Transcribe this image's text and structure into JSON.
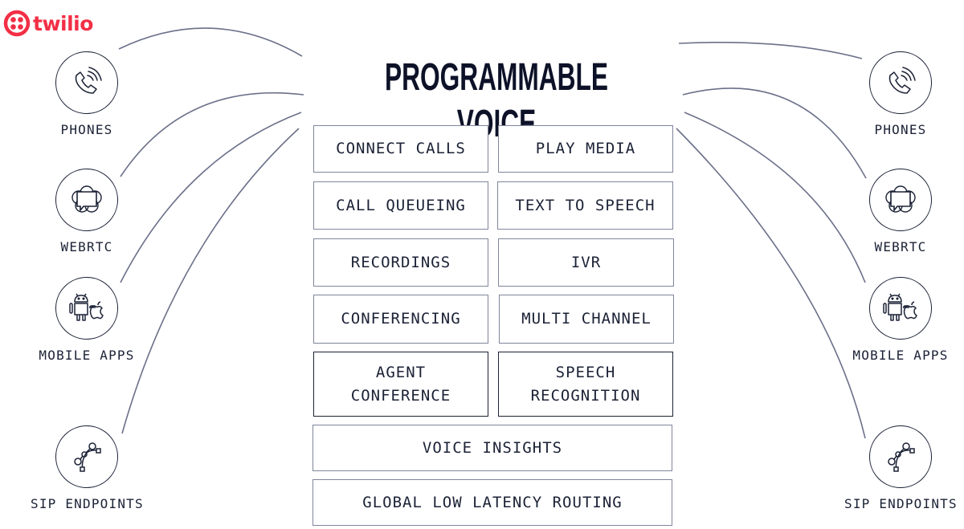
{
  "brand": {
    "name": "twilio",
    "color": "#f22f46"
  },
  "title": "PROGRAMMABLE VOICE",
  "colors": {
    "ink": "#1b2236",
    "title": "#0d1228",
    "box_border": "#80859a",
    "connector": "#6b7089"
  },
  "features": [
    {
      "label": "CONNECT CALLS"
    },
    {
      "label": "PLAY MEDIA"
    },
    {
      "label": "CALL QUEUEING"
    },
    {
      "label": "TEXT TO SPEECH"
    },
    {
      "label": "RECORDINGS"
    },
    {
      "label": "IVR"
    },
    {
      "label": "CONFERENCING"
    },
    {
      "label": "MULTI CHANNEL"
    },
    {
      "label": "AGENT\nCONFERENCE",
      "line1": "AGENT",
      "line2": "CONFERENCE"
    },
    {
      "label": "SPEECH\nRECOGNITION",
      "line1": "SPEECH",
      "line2": "RECOGNITION"
    },
    {
      "label": "VOICE INSIGHTS"
    },
    {
      "label": "GLOBAL LOW LATENCY ROUTING"
    }
  ],
  "endpoints": {
    "left": [
      {
        "label": "PHONES",
        "icon": "phone-icon"
      },
      {
        "label": "WEBRTC",
        "icon": "webrtc-icon"
      },
      {
        "label": "MOBILE APPS",
        "icon": "mobile-apps-icon"
      },
      {
        "label": "SIP ENDPOINTS",
        "icon": "sip-endpoints-icon"
      }
    ],
    "right": [
      {
        "label": "PHONES",
        "icon": "phone-icon"
      },
      {
        "label": "WEBRTC",
        "icon": "webrtc-icon"
      },
      {
        "label": "MOBILE APPS",
        "icon": "mobile-apps-icon"
      },
      {
        "label": "SIP ENDPOINTS",
        "icon": "sip-endpoints-icon"
      }
    ]
  }
}
